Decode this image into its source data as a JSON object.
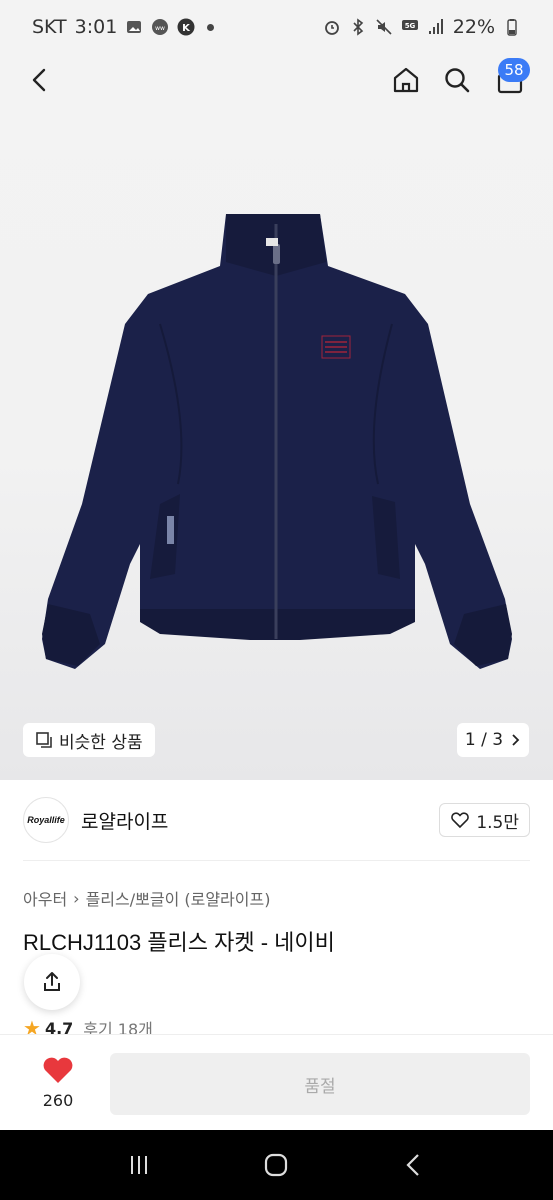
{
  "status_bar": {
    "carrier": "SKT",
    "time": "3:01",
    "battery": "22%",
    "network": "5G"
  },
  "header": {
    "cart_count": "58"
  },
  "gallery": {
    "similar_label": "비슷한 상품",
    "pager": "1 / 3"
  },
  "brand": {
    "logo_text": "Royallife",
    "name": "로얄라이프",
    "likes": "1.5만"
  },
  "breadcrumb": [
    "아우터",
    "플리스/뽀글이 (로얄라이프)"
  ],
  "product": {
    "title": "RLCHJ1103 플리스 자켓 - 네이비",
    "rating": "4.7",
    "reviews": "후기 18개"
  },
  "purchase_bar": {
    "wish_count": "260",
    "button_label": "품절"
  },
  "colors": {
    "accent": "#3b7bf6",
    "heart": "#e8383d",
    "jacket": "#1b2149"
  },
  "icons": [
    "back-icon",
    "home-icon",
    "search-icon",
    "bag-icon",
    "similar-icon",
    "chevron-right-icon",
    "heart-outline-icon",
    "share-icon",
    "star-icon",
    "heart-filled-icon",
    "recents-icon",
    "home-button-icon",
    "back-nav-icon"
  ]
}
